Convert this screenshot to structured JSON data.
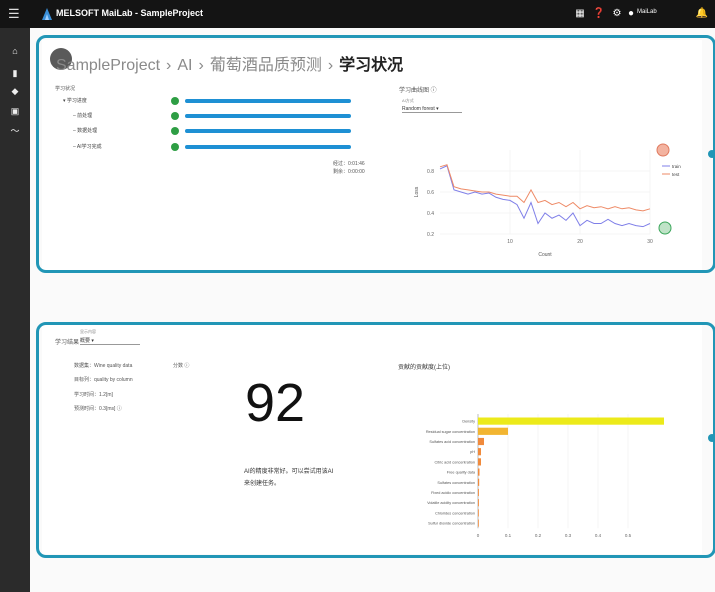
{
  "header": {
    "app_title": "MELSOFT MaiLab - SampleProject",
    "user": "MaiLab",
    "icons": [
      "menu-icon",
      "grid-icon",
      "help-icon",
      "gear-icon",
      "user-icon",
      "bell-icon"
    ]
  },
  "sidebar": {
    "items": [
      "home-icon",
      "stack-icon",
      "layers-icon",
      "box-icon",
      "trend-icon"
    ]
  },
  "breadcrumb": {
    "items": [
      "SampleProject",
      "AI",
      "葡萄酒品质预测",
      "学习状况"
    ],
    "separator": "›"
  },
  "progress": {
    "title": "学习状况",
    "rows": [
      {
        "label": "学习进度",
        "prefix": "▾"
      },
      {
        "label": "前处理",
        "prefix": "–"
      },
      {
        "label": "数据处理",
        "prefix": "–"
      },
      {
        "label": "AI学习完成",
        "prefix": "–"
      }
    ],
    "time_used": "经过：0:01:46",
    "time_left": "剩余：0:00:00"
  },
  "loss_chart": {
    "panel_title": "学习曲线图 ⓘ",
    "select_label": "AI方式",
    "select_value": "Random forest",
    "xlabel": "Count",
    "ylabel": "Loss"
  },
  "chart_data": {
    "type": "line",
    "x": [
      0,
      1,
      2,
      3,
      4,
      5,
      6,
      7,
      8,
      9,
      10,
      11,
      12,
      13,
      14,
      15,
      16,
      17,
      18,
      19,
      20,
      21,
      22,
      23,
      24,
      25,
      26,
      27,
      28,
      29,
      30
    ],
    "series": [
      {
        "name": "train",
        "color": "#7f7fe8",
        "values": [
          0.82,
          0.85,
          0.62,
          0.6,
          0.58,
          0.6,
          0.58,
          0.59,
          0.55,
          0.53,
          0.52,
          0.48,
          0.35,
          0.5,
          0.3,
          0.4,
          0.35,
          0.38,
          0.33,
          0.4,
          0.28,
          0.33,
          0.3,
          0.3,
          0.34,
          0.3,
          0.28,
          0.3,
          0.28,
          0.27,
          0.3
        ]
      },
      {
        "name": "test",
        "color": "#ee8a66",
        "values": [
          0.84,
          0.86,
          0.65,
          0.63,
          0.62,
          0.61,
          0.6,
          0.6,
          0.58,
          0.57,
          0.56,
          0.56,
          0.5,
          0.62,
          0.5,
          0.52,
          0.48,
          0.5,
          0.46,
          0.5,
          0.44,
          0.47,
          0.45,
          0.46,
          0.44,
          0.46,
          0.44,
          0.45,
          0.43,
          0.42,
          0.44
        ]
      }
    ],
    "ylim": [
      0.2,
      1.0
    ],
    "yticks": [
      0.2,
      0.4,
      0.6,
      0.8
    ],
    "xticks": [
      10,
      20,
      30
    ],
    "grid": true,
    "legend": "top-right"
  },
  "result": {
    "title": "学习结果",
    "select_label": "显示内容",
    "select_value": "概要",
    "info": [
      "数据集：Wine quality data",
      "目标列：quality by column",
      "学习时间：1.2[m]",
      "预测时间：0.3[ms] ⓘ"
    ],
    "score_label": "分数 ⓘ",
    "score": "92",
    "score_desc_1": "AI的精度非常好。可以尝试用该AI",
    "score_desc_2": "来创建任务。"
  },
  "importance": {
    "title": "贡献的贡献度(上位)",
    "categories": [
      "Density",
      "Residual sugar concentration",
      "Sulfates acid concentration",
      "pH",
      "Citric acid concentration",
      "Free quality data",
      "Sulfates concentration",
      "Fixed acidic concentration",
      "Volatile acidity concentration",
      "Chlorides concentration",
      "Sulfur dioxide concentration"
    ],
    "values": [
      0.62,
      0.1,
      0.02,
      0.01,
      0.01,
      0.005,
      0.004,
      0.003,
      0.003,
      0.002,
      0.002
    ],
    "xticks": [
      "0",
      "0.1",
      "0.2",
      "0.3",
      "0.4",
      "0.5"
    ],
    "xlim": [
      0,
      0.65
    ]
  }
}
